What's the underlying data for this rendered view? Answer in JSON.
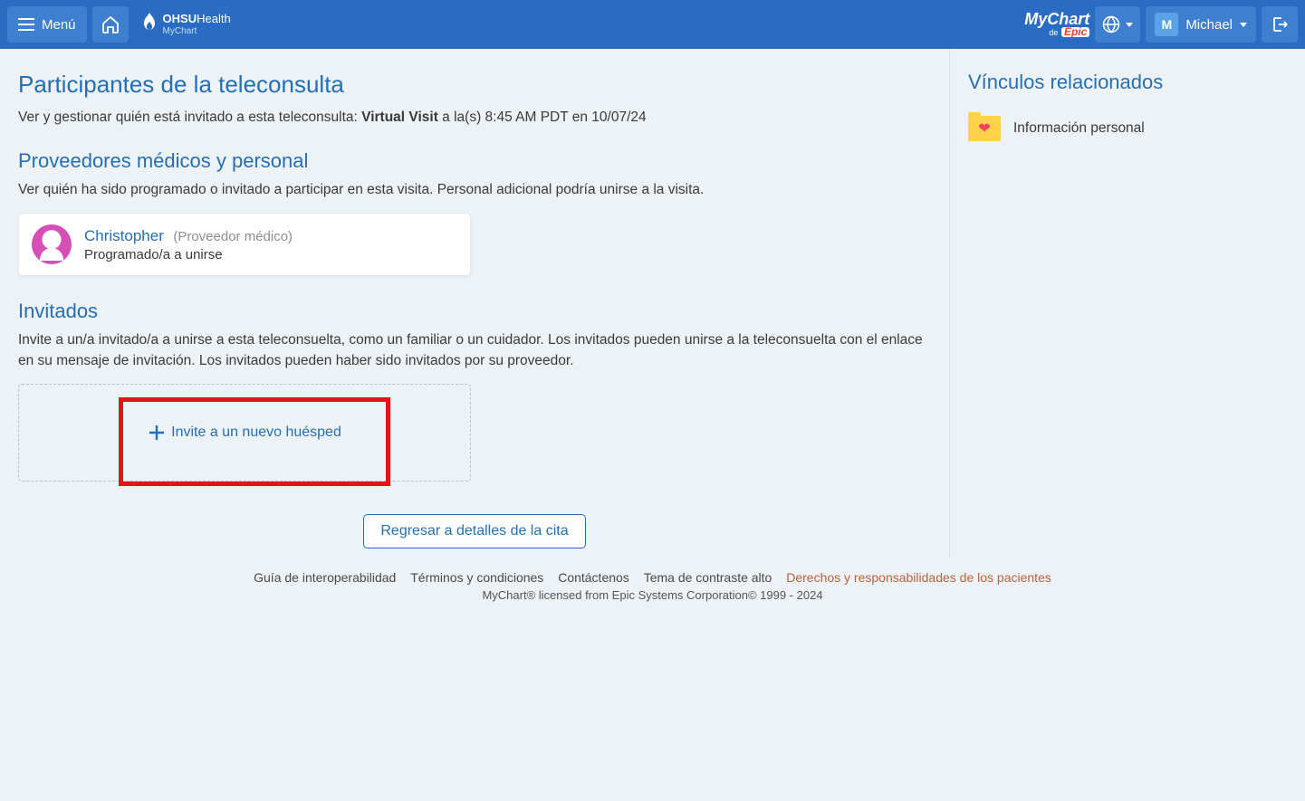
{
  "header": {
    "menu_label": "Menú",
    "user_initial": "M",
    "user_name": "Michael"
  },
  "logo": {
    "brand": "OHSU",
    "suffix": "Health",
    "sub": "MyChart"
  },
  "mychart_logo": {
    "top": "MyChart",
    "de": "de",
    "epic": "Epic"
  },
  "page": {
    "title": "Participantes de la teleconsulta",
    "subtitle_prefix": "Ver y gestionar quién está invitado a esta teleconsulta: ",
    "visit_name": "Virtual Visit",
    "subtitle_suffix": " a la(s) 8:45 AM PDT en 10/07/24"
  },
  "providers": {
    "heading": "Proveedores médicos y personal",
    "desc": "Ver quién ha sido programado o invitado a participar en esta visita. Personal adicional podría unirse a la visita.",
    "name": "Christopher",
    "role": "(Proveedor médico)",
    "status": "Programado/a a unirse"
  },
  "guests": {
    "heading": "Invitados",
    "desc": "Invite a un/a invitado/a a unirse a esta teleconsuelta, como un familiar o un cuidador. Los invitados pueden unirse a la teleconsuelta con el enlace en su mensaje de invitación. Los invitados pueden haber sido invitados por su proveedor.",
    "invite_label": "Invite a un nuevo huésped"
  },
  "back_button": "Regresar a detalles de la cita",
  "sidebar": {
    "heading": "Vínculos relacionados",
    "link1": "Información personal"
  },
  "footer": {
    "link1": "Guía de interoperabilidad",
    "link2": "Términos y condiciones",
    "link3": "Contáctenos",
    "link4": "Tema de contraste alto",
    "link5": "Derechos y responsabilidades de los pacientes",
    "copyright": "MyChart® licensed from Epic Systems Corporation© 1999 - 2024"
  }
}
